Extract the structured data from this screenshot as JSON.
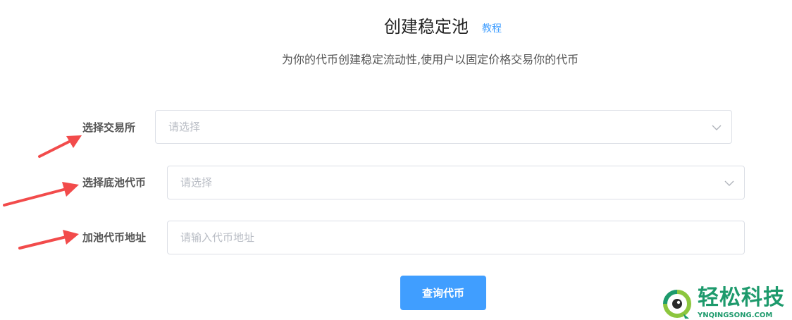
{
  "header": {
    "title": "创建稳定池",
    "tutorial_link": "教程",
    "subtitle": "为你的代币创建稳定流动性,使用户以固定价格交易你的代币"
  },
  "form": {
    "exchange": {
      "label": "选择交易所",
      "placeholder": "请选择"
    },
    "base_token": {
      "label": "选择底池代币",
      "placeholder": "请选择"
    },
    "token_address": {
      "label": "加池代币地址",
      "placeholder": "请输入代币地址"
    },
    "query_button": "查询代币"
  },
  "watermark": {
    "name": "轻松科技",
    "domain": "YNQINGSONG.COM"
  },
  "colors": {
    "accent": "#409eff",
    "arrow": "#f24b4b",
    "watermark": "#1d9a6c"
  },
  "icons": {
    "select_chevron": "chevron-down-icon",
    "annotation_arrow": "arrow-icon"
  }
}
